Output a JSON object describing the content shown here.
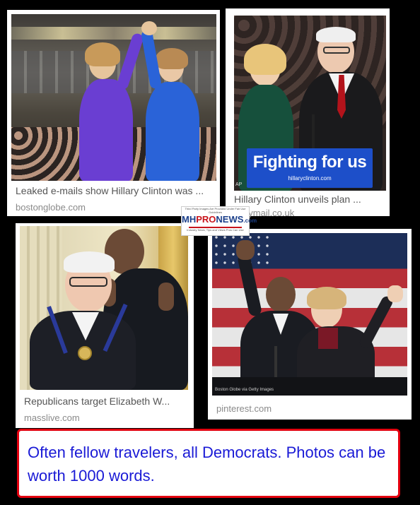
{
  "results": [
    {
      "caption": "Leaked e-mails show Hillary Clinton was ...",
      "source": "bostonglobe.com"
    },
    {
      "caption": "Hillary Clinton unveils plan ...",
      "source": "dailymail.co.uk",
      "photo_sign_text": "Fighting for us",
      "photo_sign_subtext": "hillaryclinton.com",
      "photo_corner_tag": "AP"
    },
    {
      "caption": "Republicans target Elizabeth W...",
      "source": "masslive.com"
    },
    {
      "caption": "",
      "source": "pinterest.com",
      "photo_credit": "Boston Globe via Getty Images"
    }
  ],
  "watermark": {
    "notice": "Third Party Images Are Provided Under Fair Use Guidelines",
    "logo_prefix": "MH",
    "logo_mid": "PRO",
    "logo_suffix": "NEWS",
    "logo_tld": ".com",
    "tagline": "Industry News, Tips and Views Pros Can Use"
  },
  "note": {
    "text": "Often fellow travelers, all Democrats. Photos can be worth 1000 words."
  },
  "colors": {
    "background": "#000000",
    "note_border": "#e3000f",
    "note_text": "#1a1ad6",
    "caption": "#555555",
    "source": "#8a8a8a"
  }
}
